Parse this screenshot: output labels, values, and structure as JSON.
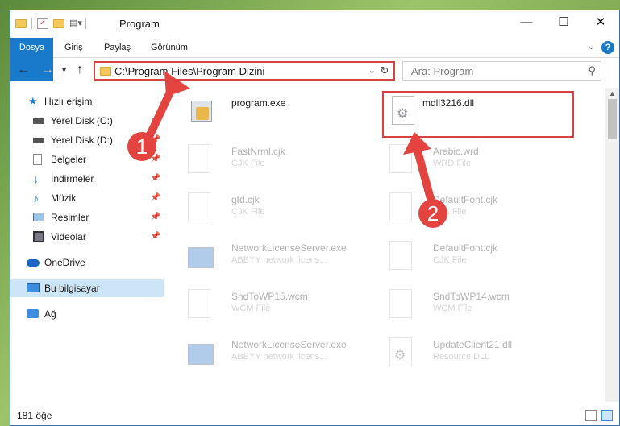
{
  "window": {
    "title": "Program"
  },
  "ribbon": {
    "tabs": [
      "Dosya",
      "Giriş",
      "Paylaş",
      "Görünüm"
    ]
  },
  "address": {
    "path": "C:\\Program Files\\Program Dizini"
  },
  "search": {
    "placeholder": "Ara: Program"
  },
  "sidebar": {
    "items": [
      {
        "label": "Hızlı erişim",
        "icon": "star-icon"
      },
      {
        "label": "Yerel Disk (C:)",
        "icon": "disk-icon"
      },
      {
        "label": "Yerel Disk (D:)",
        "icon": "disk-icon"
      },
      {
        "label": "Belgeler",
        "icon": "documents-icon"
      },
      {
        "label": "İndirmeler",
        "icon": "download-icon"
      },
      {
        "label": "Müzik",
        "icon": "music-icon"
      },
      {
        "label": "Resimler",
        "icon": "pictures-icon"
      },
      {
        "label": "Videolar",
        "icon": "video-icon"
      },
      {
        "label": "OneDrive",
        "icon": "cloud-icon"
      },
      {
        "label": "Bu bilgisayar",
        "icon": "computer-icon"
      },
      {
        "label": "Ağ",
        "icon": "network-icon"
      }
    ]
  },
  "files": [
    {
      "name": "program.exe",
      "type": ""
    },
    {
      "name": "mdll3216.dll",
      "type": ""
    },
    {
      "name": "FastNrml.cjk",
      "type": "CJK File"
    },
    {
      "name": "Arabic.wrd",
      "type": "WRD File"
    },
    {
      "name": "gtd.cjk",
      "type": "CJK File"
    },
    {
      "name": "DefaultFont.cjk",
      "type": "CJK File"
    },
    {
      "name": "NetworkLicenseServer.exe",
      "type": "ABBYY network licens..."
    },
    {
      "name": "DefaultFont.cjk",
      "type": "CJK File"
    },
    {
      "name": "SndToWP15.wcm",
      "type": "WCM File"
    },
    {
      "name": "SndToWP14.wcm",
      "type": "WCM File"
    },
    {
      "name": "NetworkLicenseServer.exe",
      "type": "ABBYY network licens..."
    },
    {
      "name": "UpdateClient21.dll",
      "type": "Resource DLL"
    }
  ],
  "status": {
    "count": "181 öğe"
  },
  "annotations": {
    "step1": "1",
    "step2": "2"
  },
  "colors": {
    "accent": "#1979ca",
    "highlight": "#d94040"
  }
}
